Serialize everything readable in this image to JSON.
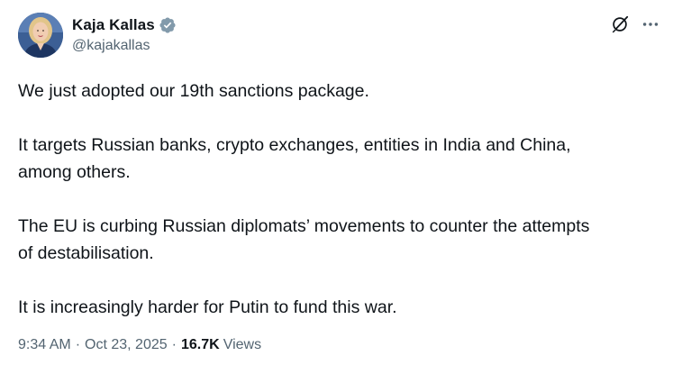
{
  "author": {
    "display_name": "Kaja Kallas",
    "handle": "@kajakallas",
    "verified_icon": "verified-badge-icon",
    "badge_color": "#829aab"
  },
  "actions": {
    "grok_icon": "grok-icon",
    "more_icon": "more-options-icon"
  },
  "tweet": {
    "paragraphs": [
      "We just adopted our 19th sanctions package.",
      "It targets Russian banks, crypto exchanges, entities in India and China,\namong others.",
      "The EU is curbing Russian diplomats’ movements to counter the attempts\nof destabilisation.",
      "It is increasingly harder for Putin to fund this war."
    ]
  },
  "meta": {
    "time": "9:34 AM",
    "separator": "·",
    "date": "Oct 23, 2025",
    "views_count": "16.7K",
    "views_label": "Views"
  },
  "colors": {
    "text": "#0f1419",
    "secondary": "#536471"
  }
}
